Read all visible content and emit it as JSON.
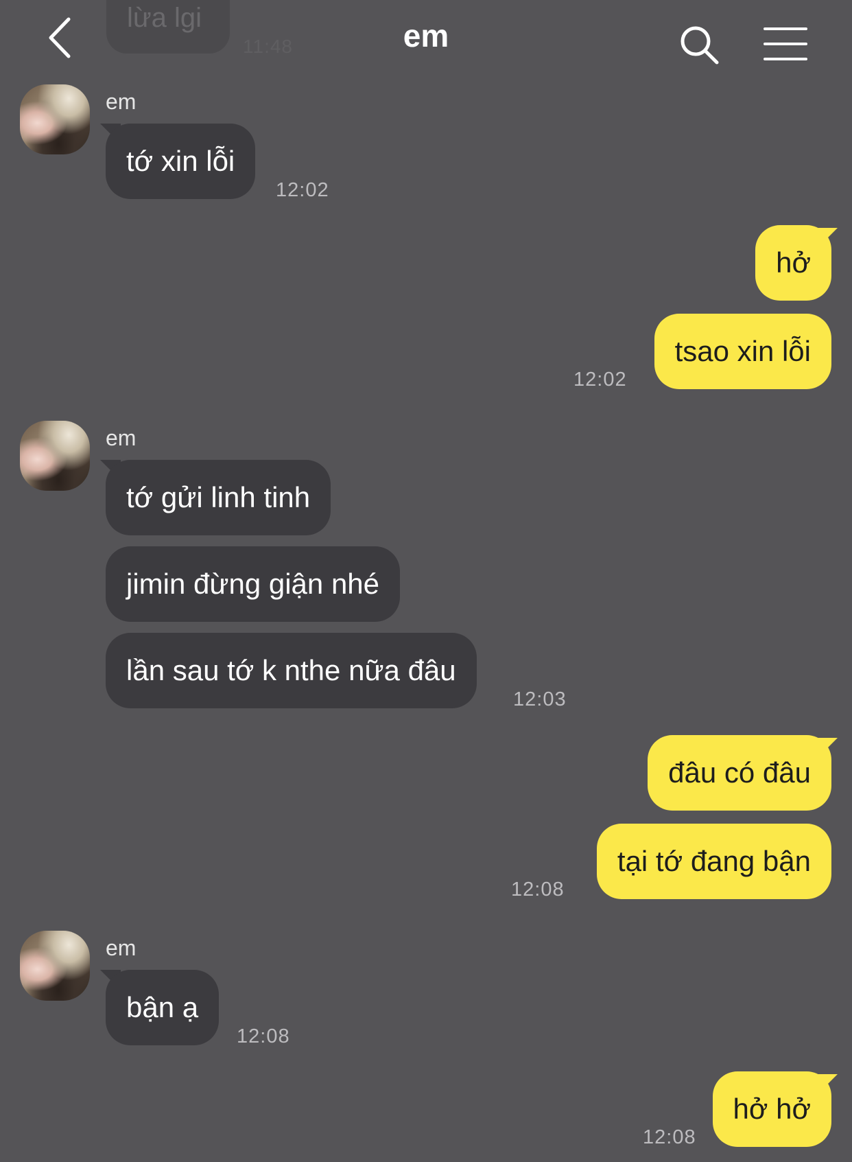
{
  "header": {
    "title": "em",
    "back_icon": "chevron-left-icon",
    "search_icon": "search-icon",
    "menu_icon": "hamburger-menu-icon"
  },
  "partial_previous": {
    "text": "lừa lgi",
    "time": "11:48"
  },
  "colors": {
    "background": "#555457",
    "incoming_bubble": "#3c3b3f",
    "outgoing_bubble": "#fbe84a",
    "outgoing_text": "#1d1d1d"
  },
  "messages": [
    {
      "direction": "incoming",
      "sender": "em",
      "text": "tớ xin lỗi",
      "time": "12:02"
    },
    {
      "direction": "outgoing",
      "text": "hở"
    },
    {
      "direction": "outgoing",
      "text": "tsao xin lỗi",
      "time": "12:02"
    },
    {
      "direction": "incoming",
      "sender": "em",
      "text": "tớ gửi linh tinh"
    },
    {
      "direction": "incoming",
      "text": "jimin đừng giận nhé"
    },
    {
      "direction": "incoming",
      "text": "lần sau tớ k nthe nữa đâu",
      "time": "12:03"
    },
    {
      "direction": "outgoing",
      "text": "đâu có đâu"
    },
    {
      "direction": "outgoing",
      "text": "tại tớ đang bận",
      "time": "12:08"
    },
    {
      "direction": "incoming",
      "sender": "em",
      "text": "bận ạ",
      "time": "12:08"
    },
    {
      "direction": "outgoing",
      "text": "hở hở",
      "time": "12:08"
    }
  ]
}
